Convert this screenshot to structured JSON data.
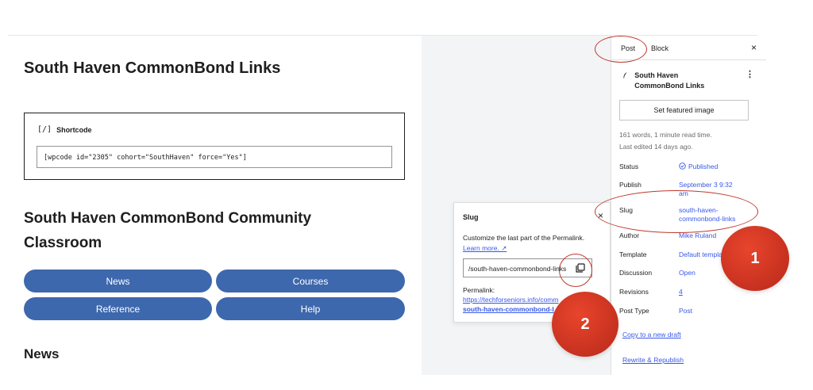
{
  "editor": {
    "title": "South Haven CommonBond Links",
    "shortcode": {
      "label": "Shortcode",
      "label_icon": "[/]",
      "value": "[wpcode id=\"2305\" cohort=\"SouthHaven\" force=\"Yes\"]"
    },
    "heading2": "South Haven CommonBond Community Classroom",
    "buttons": [
      {
        "label": "News"
      },
      {
        "label": "Courses"
      },
      {
        "label": "Reference"
      },
      {
        "label": "Help"
      }
    ],
    "heading3": "News"
  },
  "slug_popover": {
    "title": "Slug",
    "close": "×",
    "description": "Customize the last part of the Permalink.",
    "learn_more": "Learn more. ↗",
    "input_value": "/south-haven-commonbond-links",
    "permalink_label": "Permalink:",
    "permalink_line1": "https://techforseniors.info/comm",
    "permalink_line2": "south-haven-commonbond-l"
  },
  "sidebar": {
    "tabs": [
      {
        "label": "Post",
        "active": true
      },
      {
        "label": "Block",
        "active": false
      }
    ],
    "close": "×",
    "post_title": "South Haven CommonBond Links",
    "more_icon": "⋮",
    "featured_image_button": "Set featured image",
    "meta_line1": "161 words, 1 minute read time.",
    "meta_line2": "Last edited 14 days ago.",
    "fields": [
      {
        "key": "Status",
        "value": "Published"
      },
      {
        "key": "Publish",
        "value": "September 3 9:32 am"
      },
      {
        "key": "Slug",
        "value": "south-haven-commonbond-links"
      },
      {
        "key": "Author",
        "value": "Mike Ruland"
      },
      {
        "key": "Template",
        "value": "Default templa"
      },
      {
        "key": "Discussion",
        "value": "Open"
      },
      {
        "key": "Revisions",
        "value": "4"
      },
      {
        "key": "Post Type",
        "value": "Post"
      }
    ],
    "links": [
      "Copy to a new draft",
      "Rewrite & Republish"
    ]
  },
  "annotations": {
    "badge1": "1",
    "badge2": "2",
    "accent": "#c0392b"
  },
  "colors": {
    "button_blue": "#3e68ad",
    "link_blue": "#3858e9",
    "canvas_gray": "#f2f4f6"
  }
}
